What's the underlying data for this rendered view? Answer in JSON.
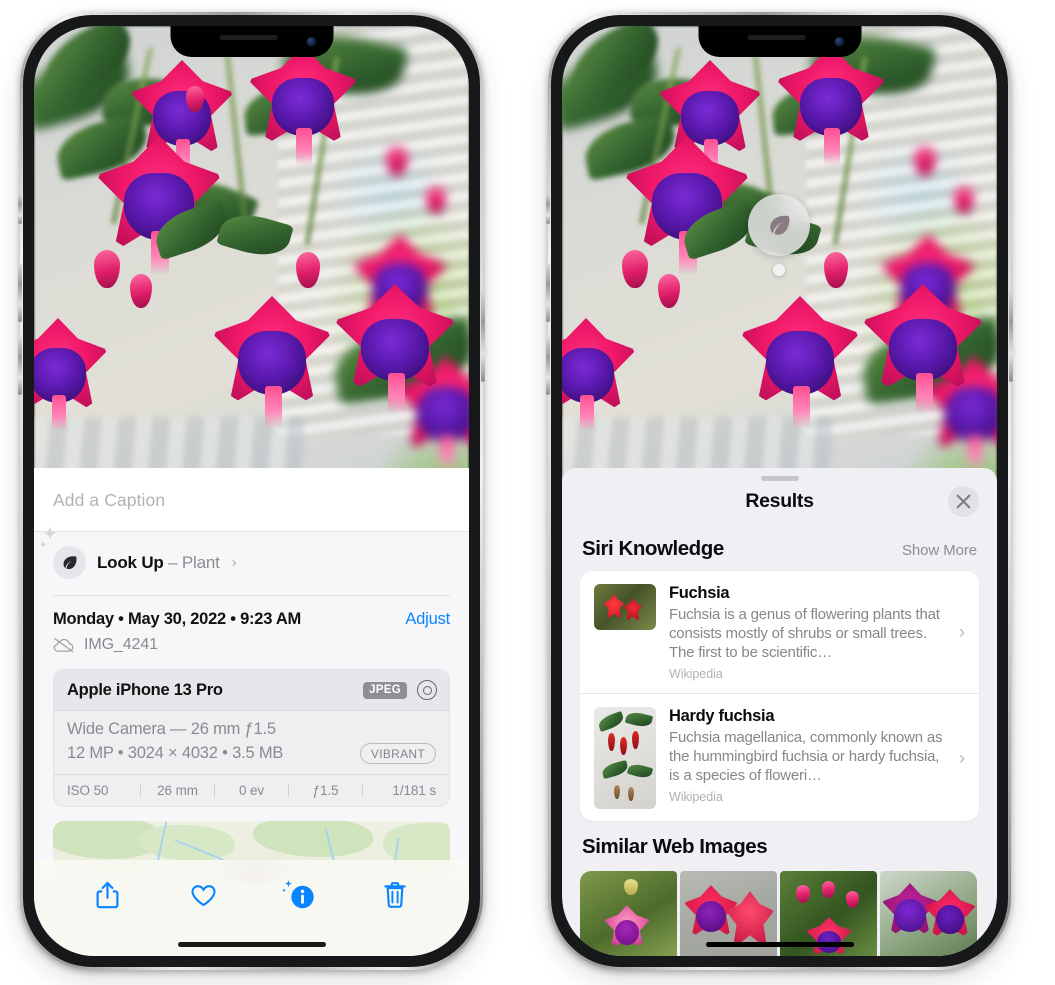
{
  "page": {
    "background": "#ffffff",
    "device_count": 2,
    "device_name": "iPhone"
  },
  "left_phone": {
    "screen_name": "photo-detail-info",
    "caption": {
      "placeholder": "Add a Caption",
      "value": ""
    },
    "look_up": {
      "icon": "leaf-icon",
      "sparkle_icon": "sparkles-icon",
      "label": "Look Up",
      "dash": "–",
      "subject": "Plant",
      "chevron": "›"
    },
    "metadata": {
      "date_line": "Monday • May 30, 2022 • 9:23 AM",
      "adjust_label": "Adjust",
      "cloud_icon": "cloud-slash-icon",
      "file_name": "IMG_4241"
    },
    "exif_card": {
      "device": "Apple iPhone 13 Pro",
      "format_badge": "JPEG",
      "lens_icon": "lens-icon",
      "lens_line": "Wide Camera — 26 mm ƒ1.5",
      "size_line": "12 MP • 3024 × 4032 • 3.5 MB",
      "style_badge": "VIBRANT",
      "stats": [
        "ISO 50",
        "26 mm",
        "0 ev",
        "ƒ1.5",
        "1/181 s"
      ]
    },
    "map": {
      "name": "location-map-thumbnail",
      "pin_label": ""
    },
    "toolbar": {
      "items": [
        {
          "name": "share-icon",
          "label": "Share",
          "active": false
        },
        {
          "name": "heart-icon",
          "label": "Favorite",
          "active": false
        },
        {
          "name": "info-sparkle-icon",
          "label": "Info",
          "active": true
        },
        {
          "name": "trash-icon",
          "label": "Delete",
          "active": false
        }
      ]
    },
    "accent_color": "#0a84ff"
  },
  "right_phone": {
    "screen_name": "visual-look-up-results",
    "visual_badge": {
      "icon": "leaf-icon",
      "name": "visual-look-up-badge"
    },
    "sheet": {
      "grabber": "drag-handle",
      "title": "Results",
      "close_icon": "close-icon"
    },
    "siri_knowledge": {
      "title": "Siri Knowledge",
      "action": "Show More",
      "cards": [
        {
          "title": "Fuchsia",
          "description": "Fuchsia is a genus of flowering plants that consists mostly of shrubs or small trees. The first to be scientific…",
          "source": "Wikipedia",
          "chevron": "›",
          "thumbnail": "fuchsia-red-flowers-thumbnail"
        },
        {
          "title": "Hardy fuchsia",
          "description": "Fuchsia magellanica, commonly known as the hummingbird fuchsia or hardy fuchsia, is a species of floweri…",
          "source": "Wikipedia",
          "chevron": "›",
          "thumbnail": "hardy-fuchsia-branch-thumbnail"
        }
      ]
    },
    "similar_web_images": {
      "title": "Similar Web Images",
      "images": [
        {
          "name": "web-image-1",
          "alt": "pink and magenta fuchsia with green leaves"
        },
        {
          "name": "web-image-2",
          "alt": "red fuchsia blossoms close up"
        },
        {
          "name": "web-image-3",
          "alt": "fuchsia shrub with many buds"
        },
        {
          "name": "web-image-4",
          "alt": "purple and crimson fuchsia blooms"
        }
      ]
    }
  }
}
